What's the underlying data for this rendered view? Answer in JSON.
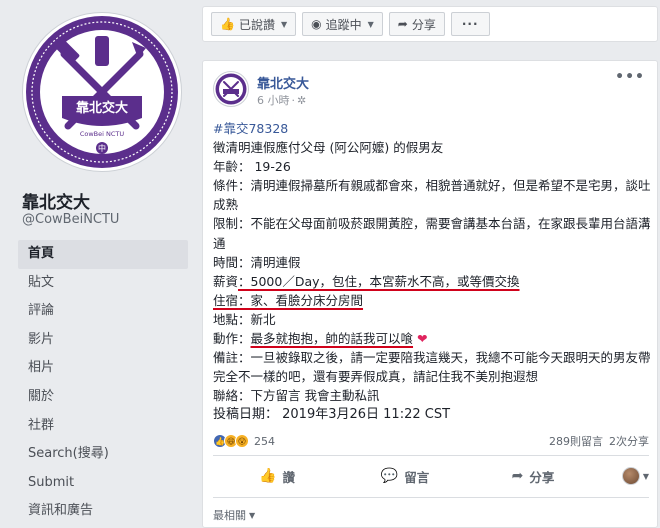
{
  "page": {
    "name": "靠北交大",
    "handle": "@CowBeiNCTU",
    "logo_text": "靠北交大",
    "logo_subtext": "CowBei NCTU",
    "logo_seal": "中"
  },
  "nav": [
    {
      "label": "首頁",
      "active": true
    },
    {
      "label": "貼文"
    },
    {
      "label": "評論"
    },
    {
      "label": "影片"
    },
    {
      "label": "相片"
    },
    {
      "label": "關於"
    },
    {
      "label": "社群"
    },
    {
      "label": "Search(搜尋)"
    },
    {
      "label": "Submit"
    },
    {
      "label": "資訊和廣告"
    }
  ],
  "action_bar": {
    "liked_label": "已說讚",
    "following_label": "追蹤中",
    "share_label": "分享",
    "more_label": "···"
  },
  "post": {
    "author": "靠北交大",
    "time": "6 小時",
    "more_label": "•••",
    "hashtag": "#靠交78328",
    "lines": {
      "l1": "徵清明連假應付父母 (阿公阿嬤) 的假男友",
      "l2": "年齡： 19-26",
      "l3": "條件：清明連假掃墓所有親戚都會來，相貌普通就好，但是希望不是宅男，談吐成熟",
      "l4": "限制：不能在父母面前吸菸跟開黃腔，需要會講基本台語，在家跟長輩用台語溝通",
      "l5": "時間：清明連假",
      "l6_label": "薪資",
      "l6_value": "：5000／Day，包住，本宮薪水不高，或等價交換",
      "l7_label": "住宿",
      "l7_value": "：家、看臉分床分房間",
      "l8": "地點：新北",
      "l9_label": "動作：",
      "l9_value": "最多就抱抱，帥的話我可以喰",
      "l9_heart": "❤",
      "l10": "備註：一旦被錄取之後，請一定要陪我這幾天，我總不可能今天跟明天的男友帶完全不一樣的吧，還有要弄假成真，請記住我不美別抱遐想",
      "l11": "聯絡：下方留言 我會主動私訊"
    },
    "submitted": "投稿日期： 2019年3月26日 11:22 CST",
    "reaction_count": "254",
    "comments": "289則留言",
    "shares": "2次分享",
    "like_label": "讚",
    "comment_label": "留言",
    "share_label": "分享",
    "most_relevant": "最相關"
  },
  "colors": {
    "brand_purple": "#5b2e8c",
    "link_blue": "#385898",
    "underline_red": "#d0021b"
  }
}
